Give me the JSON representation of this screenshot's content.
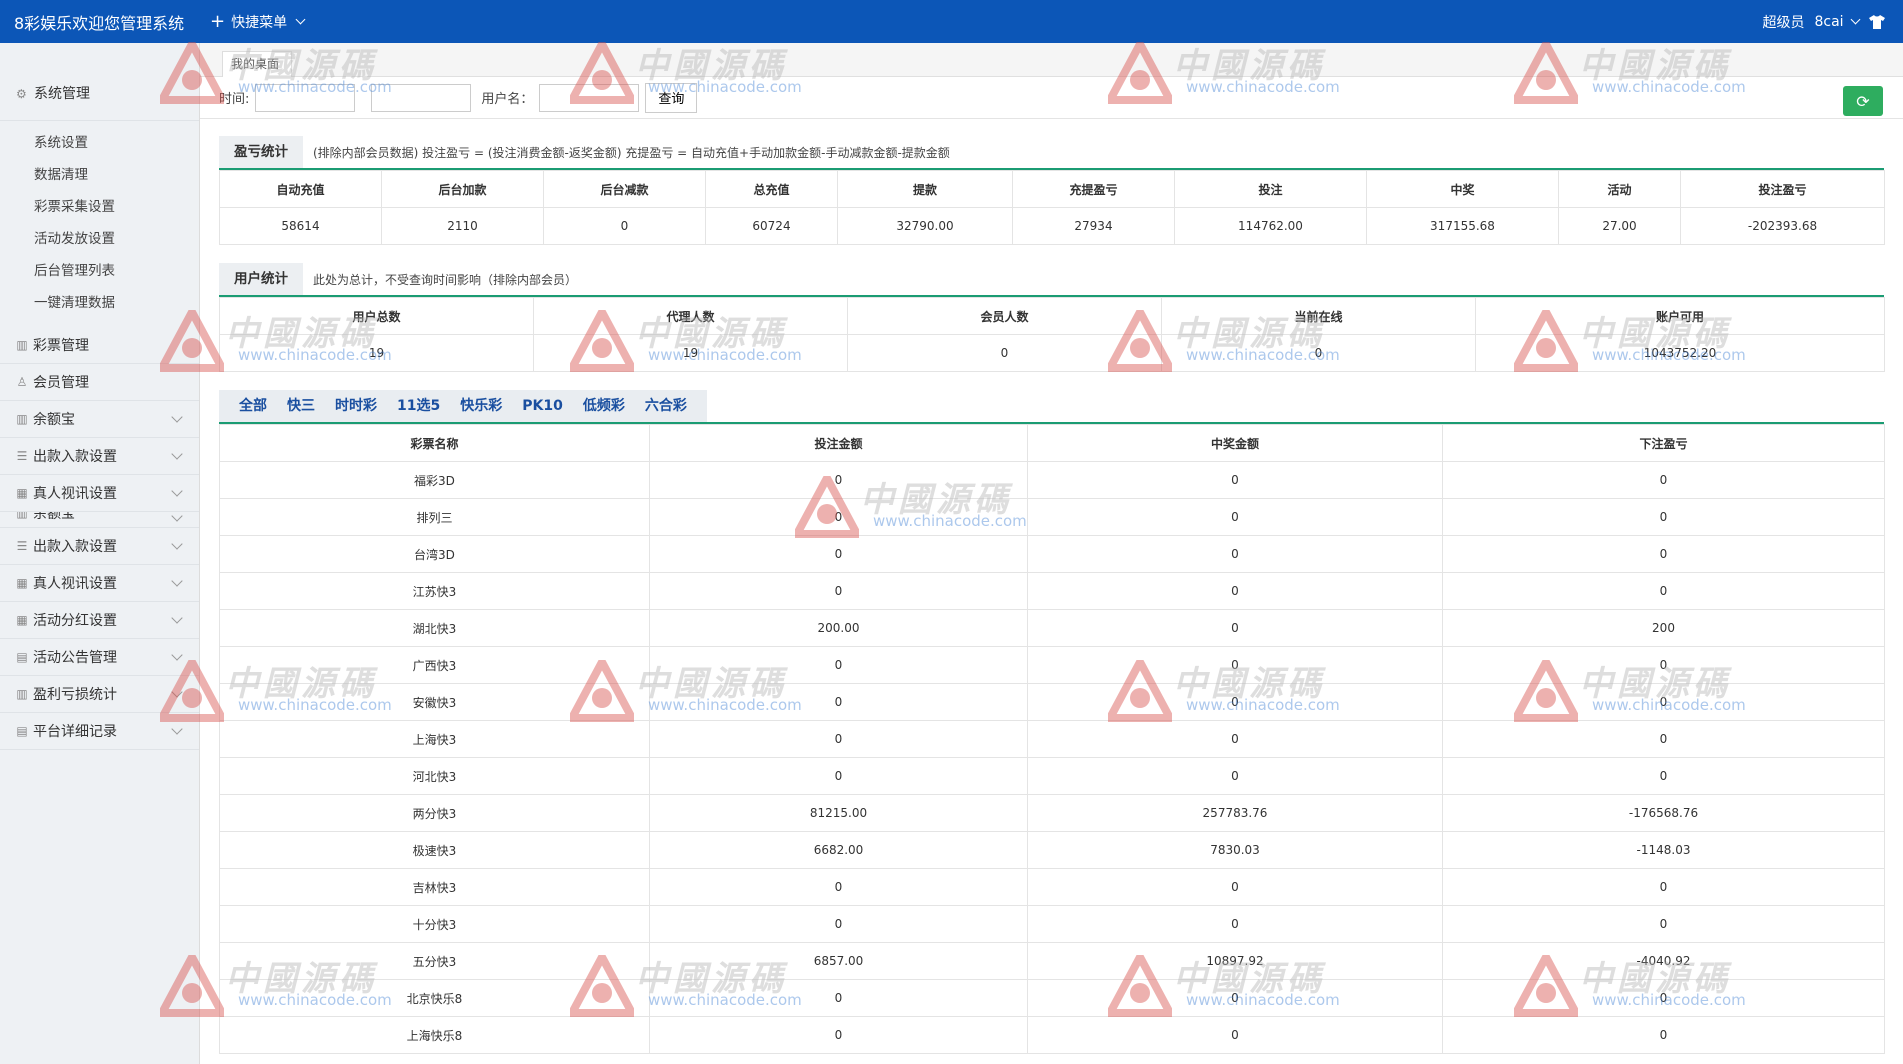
{
  "header": {
    "brand": "8彩娱乐欢迎您管理系统",
    "quick_menu": "快捷菜单",
    "role": "超级员",
    "username": "8cai"
  },
  "sidebar": {
    "system_head": "系统管理",
    "sub_items": [
      "系统设置",
      "数据清理",
      "彩票采集设置",
      "活动发放设置",
      "后台管理列表",
      "一键清理数据"
    ],
    "menu_items": [
      {
        "label": "彩票管理",
        "icon": "chart-icon",
        "chevron": false
      },
      {
        "label": "会员管理",
        "icon": "user-icon",
        "chevron": false
      },
      {
        "label": "余额宝",
        "icon": "chart-icon",
        "chevron": true
      },
      {
        "label": "出款入款设置",
        "icon": "list-icon",
        "chevron": true
      },
      {
        "label": "真人视讯设置",
        "icon": "grid-icon",
        "chevron": true
      }
    ],
    "partial_item": "余额宝",
    "menu_items_2": [
      {
        "label": "出款入款设置",
        "icon": "list-icon"
      },
      {
        "label": "真人视讯设置",
        "icon": "grid-icon"
      },
      {
        "label": "活动分红设置",
        "icon": "grid-icon"
      },
      {
        "label": "活动公告管理",
        "icon": "doc-icon"
      },
      {
        "label": "盈利亏损统计",
        "icon": "chart-icon"
      },
      {
        "label": "平台详细记录",
        "icon": "doc-icon"
      }
    ]
  },
  "tab": {
    "home": "我的桌面"
  },
  "search": {
    "time_label": "时间:",
    "user_label": "用户名：",
    "query_button": "查询"
  },
  "profit": {
    "title": "盈亏统计",
    "note": "(排除内部会员数据)  投注盈亏 = (投注消费金额-返奖金额)    充提盈亏 = 自动充值+手动加款金额-手动减款金额-提款金额",
    "headers": [
      "自动充值",
      "后台加款",
      "后台减款",
      "总充值",
      "提款",
      "充提盈亏",
      "投注",
      "中奖",
      "活动",
      "投注盈亏"
    ],
    "values": [
      "58614",
      "2110",
      "0",
      "60724",
      "32790.00",
      "27934",
      "114762.00",
      "317155.68",
      "27.00",
      "-202393.68"
    ]
  },
  "users": {
    "title": "用户统计",
    "note": "此处为总计，不受查询时间影响（排除内部会员）",
    "headers": [
      "用户总数",
      "代理人数",
      "会员人数",
      "当前在线",
      "账户可用"
    ],
    "values": [
      "19",
      "19",
      "0",
      "0",
      "1043752.20"
    ]
  },
  "lottery": {
    "tabs": [
      "全部",
      "快三",
      "时时彩",
      "11选5",
      "快乐彩",
      "PK10",
      "低频彩",
      "六合彩"
    ],
    "headers": [
      "彩票名称",
      "投注金额",
      "中奖金额",
      "下注盈亏"
    ],
    "rows": [
      [
        "福彩3D",
        "0",
        "0",
        "0"
      ],
      [
        "排列三",
        "0",
        "0",
        "0"
      ],
      [
        "台湾3D",
        "0",
        "0",
        "0"
      ],
      [
        "江苏快3",
        "0",
        "0",
        "0"
      ],
      [
        "湖北快3",
        "200.00",
        "0",
        "200"
      ],
      [
        "广西快3",
        "0",
        "0",
        "0"
      ],
      [
        "安徽快3",
        "0",
        "0",
        "0"
      ],
      [
        "上海快3",
        "0",
        "0",
        "0"
      ],
      [
        "河北快3",
        "0",
        "0",
        "0"
      ],
      [
        "两分快3",
        "81215.00",
        "257783.76",
        "-176568.76"
      ],
      [
        "极速快3",
        "6682.00",
        "7830.03",
        "-1148.03"
      ],
      [
        "吉林快3",
        "0",
        "0",
        "0"
      ],
      [
        "十分快3",
        "0",
        "0",
        "0"
      ],
      [
        "五分快3",
        "6857.00",
        "10897.92",
        "-4040.92"
      ],
      [
        "北京快乐8",
        "0",
        "0",
        "0"
      ],
      [
        "上海快乐8",
        "0",
        "0",
        "0"
      ]
    ]
  },
  "watermark": {
    "text": "中國源碼",
    "url": "www.chinacode.com"
  }
}
